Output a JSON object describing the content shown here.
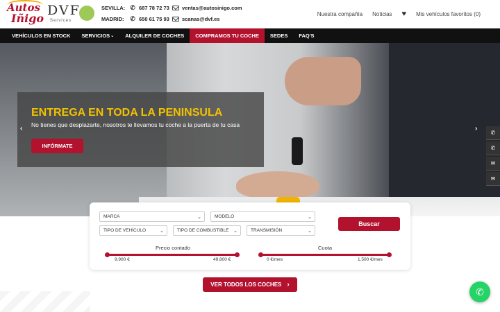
{
  "logo": {
    "autos": "Autos",
    "inigo": "Iñigo",
    "dvf": "DVF",
    "services": "Services"
  },
  "contacts": {
    "sevilla": {
      "city": "SEVILLA:",
      "phone": "687 78 72 73",
      "email": "ventas@autosinigo.com"
    },
    "madrid": {
      "city": "MADRID:",
      "phone": "650 61 75 93",
      "email": "scanas@dvf.es"
    }
  },
  "toplinks": {
    "company": "Nuestra compañía",
    "news": "Noticias",
    "favorites": "Mis vehículos favoritos (0)"
  },
  "nav": [
    "VEHÍCULOS EN STOCK",
    "SERVICIOS",
    "ALQUILER DE COCHES",
    "COMPRAMOS TU COCHE",
    "SEDES",
    "FAQ'S"
  ],
  "hero": {
    "title": "ENTREGA EN TODA LA PENINSULA",
    "subtitle": "No tienes que desplazarte, nosotros te llevamos tu coche a la puerta de tu casa",
    "button": "INFÓRMATE"
  },
  "search": {
    "marca": "MARCA",
    "modelo": "MODELO",
    "tipo_vehiculo": "TIPO DE VEHÍCULO",
    "tipo_combustible": "TIPO DE COMBUSTIBLE",
    "transmision": "TRANSMISIÓN",
    "buscar": "Buscar",
    "precio": {
      "label": "Precio contado",
      "min": "9.900 €",
      "max": "49.800 €"
    },
    "cuota": {
      "label": "Cuota",
      "min": "0 €/mes",
      "max": "1.500 €/mes"
    }
  },
  "cta": "VER TODOS LOS COCHES",
  "colors": {
    "brand": "#b3122f",
    "accent": "#f2c200",
    "nav_bg": "#111111",
    "whatsapp": "#25d366"
  }
}
